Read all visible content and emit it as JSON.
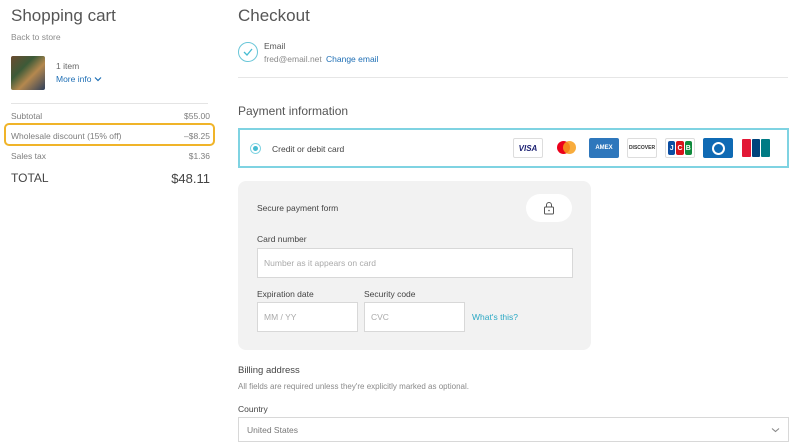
{
  "cart": {
    "title": "Shopping cart",
    "back_link": "Back to store",
    "item_count": "1 item",
    "more_info": "More info",
    "subtotal_label": "Subtotal",
    "subtotal_value": "$55.00",
    "discount_label": "Wholesale discount (15% off)",
    "discount_value": "–$8.25",
    "tax_label": "Sales tax",
    "tax_value": "$1.36",
    "total_label": "TOTAL",
    "total_value": "$48.11",
    "highlight_color": "#f0b429"
  },
  "checkout": {
    "title": "Checkout",
    "email_label": "Email",
    "email_value": "fred@email.net",
    "change_email": "Change email",
    "payment_title": "Payment information",
    "card_option_label": "Credit or debit card",
    "card_logos": [
      "visa-logo",
      "mastercard-logo",
      "amex-logo",
      "discover-logo",
      "jcb-logo",
      "diners-logo",
      "unionpay-logo"
    ],
    "accent_color": "#45bcd2",
    "card_logo_text": {
      "visa": "VISA",
      "amex": "AMEX",
      "discover": "DISCOVER",
      "jcb": [
        "J",
        "C",
        "B"
      ]
    },
    "secure_form_label": "Secure payment form",
    "card_number_label": "Card number",
    "card_number_placeholder": "Number as it appears on card",
    "expiration_label": "Expiration date",
    "expiration_placeholder": "MM / YY",
    "security_label": "Security code",
    "security_placeholder": "CVC",
    "whats_this": "What's this?",
    "billing_title": "Billing address",
    "billing_note": "All fields are required unless they're explicitly marked as optional.",
    "country_label": "Country",
    "country_value": "United States"
  }
}
